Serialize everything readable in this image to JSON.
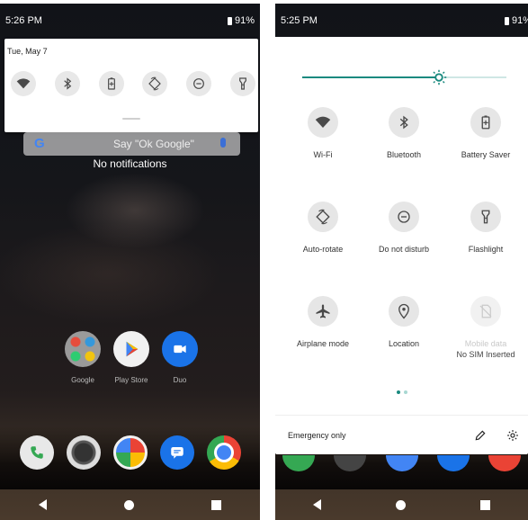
{
  "left": {
    "status": {
      "time": "5:26 PM",
      "battery": "91%"
    },
    "shade": {
      "date": "Tue, May 7"
    },
    "search": {
      "logo": "G",
      "hint": "Say \"Ok Google\""
    },
    "no_notifications": "No notifications",
    "apps": [
      {
        "label": "Google"
      },
      {
        "label": "Play Store"
      },
      {
        "label": "Duo"
      }
    ]
  },
  "right": {
    "status": {
      "time": "5:25 PM",
      "battery": "91%"
    },
    "brightness_level": 0.67,
    "tiles": [
      {
        "label": "Wi-Fi"
      },
      {
        "label": "Bluetooth"
      },
      {
        "label": "Battery Saver"
      },
      {
        "label": "Auto-rotate"
      },
      {
        "label": "Do not disturb"
      },
      {
        "label": "Flashlight"
      },
      {
        "label": "Airplane mode"
      },
      {
        "label": "Location"
      },
      {
        "label": "Mobile data",
        "sublabel": "No SIM Inserted"
      }
    ],
    "footer": {
      "emergency": "Emergency only"
    }
  },
  "colors": {
    "accent": "#1a8a7f",
    "tile_bg": "#e6e6e6",
    "icon": "#4a4a4a"
  }
}
